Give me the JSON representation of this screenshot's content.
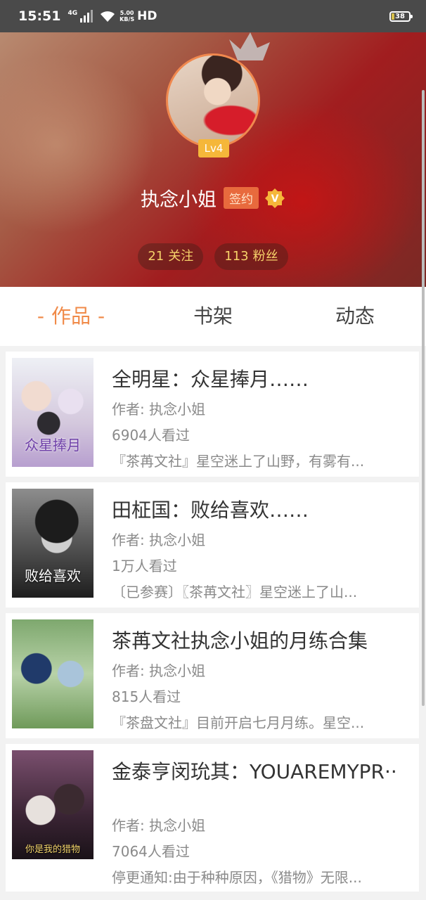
{
  "status_bar": {
    "time": "15:51",
    "network": "4G",
    "speed_value": "5.00",
    "speed_unit": "KB/S",
    "hd": "HD",
    "battery": "38"
  },
  "profile": {
    "level": "Lv4",
    "name": "执念小姐",
    "signed_badge": "签约",
    "verified_icon": "V",
    "following_count": "21",
    "following_label": "关注",
    "followers_count": "113",
    "followers_label": "粉丝"
  },
  "tabs": [
    {
      "label": "作品",
      "active": true
    },
    {
      "label": "书架",
      "active": false
    },
    {
      "label": "动态",
      "active": false
    }
  ],
  "works": [
    {
      "title": "全明星：众星捧月……",
      "author": "作者: 执念小姐",
      "views": "6904人看过",
      "desc": "『茶苒文社』星空迷上了山野，有雾有...",
      "cover_text": "众星捧月"
    },
    {
      "title": "田柾国：败给喜欢……",
      "author": "作者: 执念小姐",
      "views": "1万人看过",
      "desc": "〔已参赛〕〖茶苒文社〗星空迷上了山...",
      "cover_text": "败给喜欢"
    },
    {
      "title": "茶苒文社执念小姐的月练合集",
      "author": "作者: 执念小姐",
      "views": "815人看过",
      "desc": "『茶盘文社』目前开启七月月练。星空...",
      "cover_text": ""
    },
    {
      "title": "金泰亨闵玧其：YOUAREMYPR··",
      "author": "作者: 执念小姐",
      "views": "7064人看过",
      "desc": "停更通知:由于种种原因，《猎物》无限...",
      "cover_text": "你是我的猎物"
    }
  ]
}
